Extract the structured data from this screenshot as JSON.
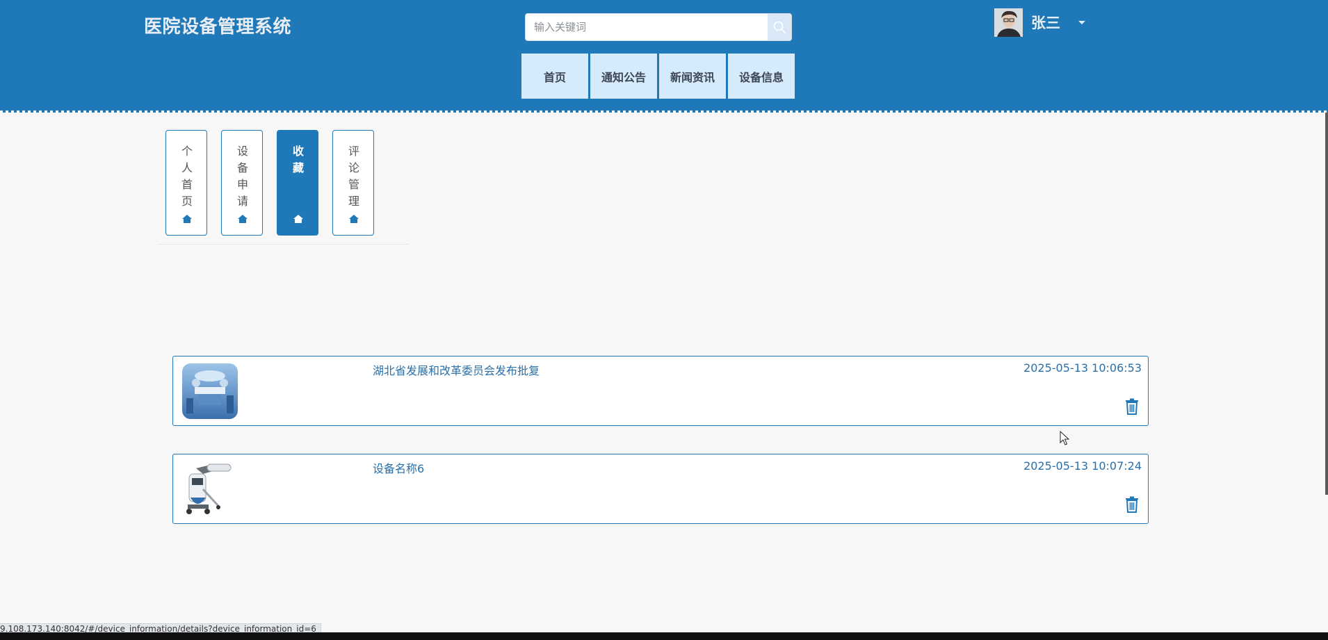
{
  "header": {
    "title": "医院设备管理系统",
    "search_placeholder": "输入关键词",
    "search_icon": "search-icon",
    "user": {
      "name": "张三",
      "avatar_icon": "avatar"
    },
    "nav": [
      {
        "label": "首页"
      },
      {
        "label": "通知公告"
      },
      {
        "label": "新闻资讯"
      },
      {
        "label": "设备信息"
      }
    ],
    "colors": {
      "primary": "#1f78b7",
      "nav_bg": "#d5eafb"
    }
  },
  "sidebar": {
    "tabs": [
      {
        "label": "个\n人\n首\n页",
        "icon": "home-icon",
        "active": false
      },
      {
        "label": "设\n备\n申\n请",
        "icon": "home-icon",
        "active": false
      },
      {
        "label": "收\n藏",
        "icon": "home-icon",
        "active": true
      },
      {
        "label": "评\n论\n管\n理",
        "icon": "home-icon",
        "active": false
      }
    ]
  },
  "favorites": [
    {
      "title": "湖北省发展和改革委员会发布批复",
      "time": "2025-05-13 10:06:53",
      "thumb": "operating-room-image",
      "delete_icon": "trash-icon"
    },
    {
      "title": "设备名称6",
      "time": "2025-05-13 10:07:24",
      "thumb": "medical-device-image",
      "delete_icon": "trash-icon"
    }
  ],
  "statusbar": {
    "url": "9.108.173.140:8042/#/device_information/details?device_information_id=6"
  }
}
